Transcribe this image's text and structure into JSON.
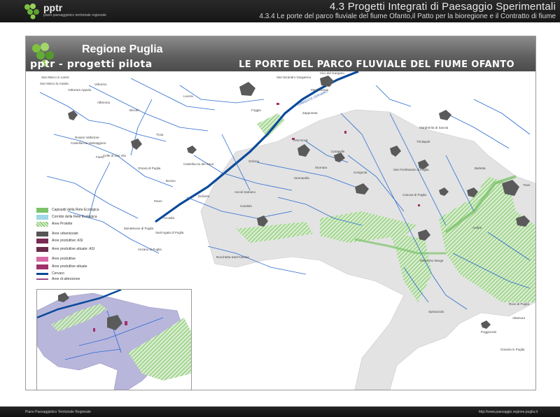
{
  "header": {
    "logo_text": "pptr",
    "logo_subtitle": "piano paesaggistico territoriale regionale",
    "title": "4.3 Progetti Integrati di Paesaggio Sperimentali",
    "subtitle": "4.3.4 Le porte del parco fluviale del fiume Ofanto,il Patto per la bioregione e il Contratto di fiume"
  },
  "banner": {
    "region": "Regione Puglia",
    "program": "pptr - progetti pilota",
    "project_title": "LE PORTE DEL PARCO FLUVIALE DEL FIUME OFANTO"
  },
  "legend": {
    "items": [
      {
        "label": "Capisaldi della Rete Ecologica",
        "color": "#7cc36b"
      },
      {
        "label": "Corridoi della Rete Ecologica",
        "color": "#9fd8e6"
      },
      {
        "label": "Aree Protette",
        "color": "#7cc36b"
      },
      {
        "label": "Aree urbanizzate",
        "color": "#555555"
      },
      {
        "label": "Aree produttive: ASI",
        "color": "#7a2a55"
      },
      {
        "label": "Aree produttive attuate: ASI",
        "color": "#6a2a4a"
      },
      {
        "label": "Aree produttive",
        "color": "#d86aa8"
      },
      {
        "label": "Aree produttive attuate",
        "color": "#a0306a"
      },
      {
        "label": "Cervaro",
        "color": "#0a4a9a"
      },
      {
        "label": "Aree di attenzione",
        "color": "#9a4a8a"
      }
    ]
  },
  "map": {
    "places": [
      "San Marco in Lamis",
      "San Nicandro Garganico",
      "Vico del Gargano",
      "San Marco la Catola",
      "Volturino",
      "Volturara Appula",
      "Alberona",
      "Biccari",
      "Lucera",
      "Foggia",
      "Manfredonia",
      "Zapponeta",
      "Roseto Valfortore",
      "Castelluccio Valmaggiore",
      "Troia",
      "Faeto",
      "Celle di San Vito",
      "Orsara di Puglia",
      "Castelluccio dei Sauri",
      "Bovino",
      "Ordona",
      "Orta Nova",
      "Stornara",
      "Stornarella",
      "Carapelle",
      "Cerignola",
      "Margherita di Savoia",
      "Trinitapoli",
      "San Ferdinando di Puglia",
      "Barletta",
      "Trani",
      "Canosa di Puglia",
      "Andria",
      "Minervino Murge",
      "Spinazzola",
      "Ascoli Satriano",
      "Candela",
      "Rocchetta Sant'Antonio",
      "Deliceto",
      "Accadia",
      "Panni",
      "Monteleone di Puglia",
      "Anzano di Puglia",
      "Sant'Agata di Puglia",
      "Poggiorsini",
      "Gravina in Puglia",
      "Ruvo di Puglia",
      "Altamura",
      "TORRENTE CERVARO"
    ]
  },
  "footer": {
    "left": "Piano Paesaggistico Territoriale Regionale",
    "right": "http://www.paesaggio.regione.puglia.it"
  },
  "colors": {
    "ecological_green": "#7cc36b",
    "river_blue": "#2a6bd0",
    "main_river": "#0a4a9a",
    "urban_gray": "#5a5a5a",
    "basin_gray": "#e3e3e3",
    "inset_basin": "#b9b6dc"
  }
}
